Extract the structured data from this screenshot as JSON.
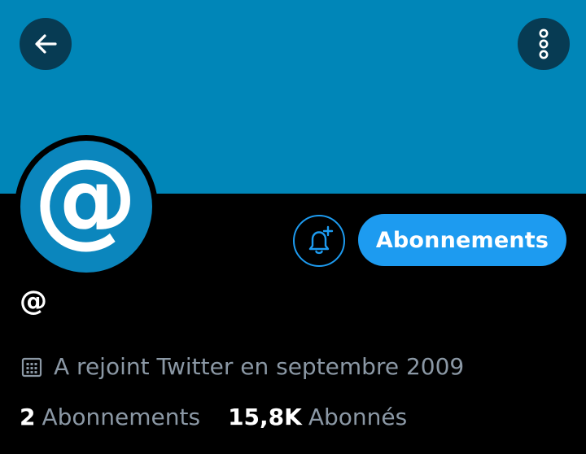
{
  "header": {
    "back_icon": "arrow-left-icon",
    "more_icon": "more-vertical-icon",
    "banner_color": "#0086b8"
  },
  "profile": {
    "avatar_symbol": "@",
    "avatar_color": "#0b86bd",
    "handle": "@",
    "joined": "A rejoint Twitter en septembre 2009",
    "joined_icon": "calendar-icon"
  },
  "actions": {
    "notify_icon": "bell-plus-icon",
    "follow_label": "Abonnements",
    "accent_color": "#1d9bf0"
  },
  "stats": {
    "following_count": "2",
    "following_label": "Abonnements",
    "followers_count": "15,8K",
    "followers_label": "Abonnés"
  }
}
